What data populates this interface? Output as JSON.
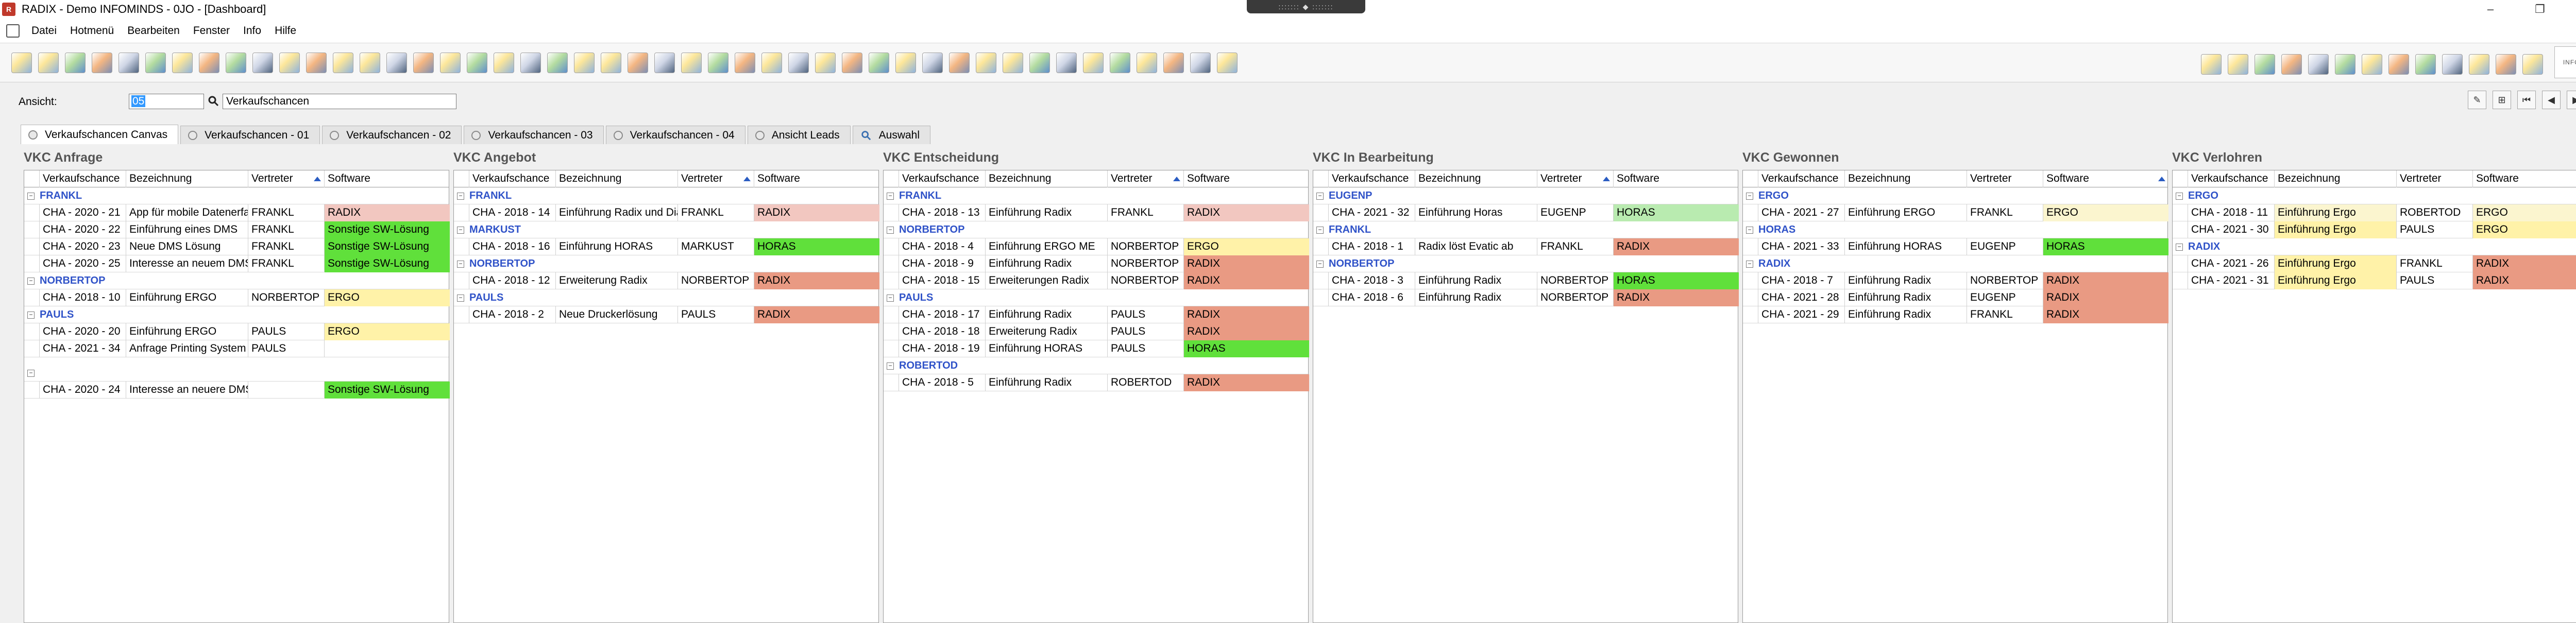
{
  "window": {
    "title": "RADIX - Demo INFOMINDS - 0JO - [Dashboard]",
    "controls": [
      "–",
      "❐",
      "✕"
    ]
  },
  "menu": [
    "Datei",
    "Hotmenü",
    "Bearbeiten",
    "Fenster",
    "Info",
    "Hilfe"
  ],
  "view": {
    "label": "Ansicht:",
    "code": "05",
    "name": "Verkaufschancen"
  },
  "tabs": [
    "Verkaufschancen Canvas",
    "Verkaufschancen - 01",
    "Verkaufschancen - 02",
    "Verkaufschancen - 03",
    "Verkaufschancen - 04",
    "Ansicht Leads",
    "Auswahl"
  ],
  "headers": [
    "Verkaufschance",
    "Bezeichnung",
    "Vertreter",
    "Software"
  ],
  "colors": {
    "RADIX": "#e99a83",
    "RADIX_LIGHT": "#f2c7c0",
    "HORAS": "#60e03b",
    "HORAS_LIGHT": "#b9ebb0",
    "ERGO": "#fff2a8",
    "ERGO_LIGHT": "#fbf5cf",
    "SW": "#60e03b",
    "group_text": "#2f52c8"
  },
  "columns": [
    {
      "title": "VKC Anfrage",
      "groups": [
        {
          "name": "FRANKL",
          "rows": [
            {
              "id": "CHA - 2020 - 21",
              "desc": "App für mobile Datenerfa",
              "rep": "FRANKL",
              "sw": "RADIX",
              "c": "RADIX_LIGHT"
            },
            {
              "id": "CHA - 2020 - 22",
              "desc": "Einführung eines DMS",
              "rep": "FRANKL",
              "sw": "Sonstige SW-Lösung",
              "c": "SW"
            },
            {
              "id": "CHA - 2020 - 23",
              "desc": "Neue DMS Lösung",
              "rep": "FRANKL",
              "sw": "Sonstige SW-Lösung",
              "c": "SW"
            },
            {
              "id": "CHA - 2020 - 25",
              "desc": "Interesse an neuem DMS",
              "rep": "FRANKL",
              "sw": "Sonstige SW-Lösung",
              "c": "SW"
            }
          ]
        },
        {
          "name": "NORBERTOP",
          "rows": [
            {
              "id": "CHA - 2018 - 10",
              "desc": "Einführung ERGO",
              "rep": "NORBERTOP",
              "sw": "ERGO",
              "c": "ERGO"
            }
          ]
        },
        {
          "name": "PAULS",
          "rows": [
            {
              "id": "CHA - 2020 - 20",
              "desc": "Einführung ERGO",
              "rep": "PAULS",
              "sw": "ERGO",
              "c": "ERGO"
            },
            {
              "id": "CHA - 2021 - 34",
              "desc": "Anfrage Printing System",
              "rep": "PAULS",
              "sw": "",
              "c": ""
            }
          ]
        },
        {
          "name": "",
          "rows": [
            {
              "id": "CHA - 2020 - 24",
              "desc": "Interesse an neuere DMS",
              "rep": "",
              "sw": "Sonstige SW-Lösung",
              "c": "SW"
            }
          ]
        }
      ]
    },
    {
      "title": "VKC Angebot",
      "groups": [
        {
          "name": "FRANKL",
          "rows": [
            {
              "id": "CHA - 2018 - 14",
              "desc": "Einführung Radix und Diamant",
              "rep": "FRANKL",
              "sw": "RADIX",
              "c": "RADIX_LIGHT"
            }
          ]
        },
        {
          "name": "MARKUST",
          "rows": [
            {
              "id": "CHA - 2018 - 16",
              "desc": "Einführung HORAS",
              "rep": "MARKUST",
              "sw": "HORAS",
              "c": "HORAS"
            }
          ]
        },
        {
          "name": "NORBERTOP",
          "rows": [
            {
              "id": "CHA - 2018 - 12",
              "desc": "Erweiterung Radix",
              "rep": "NORBERTOP",
              "sw": "RADIX",
              "c": "RADIX"
            }
          ]
        },
        {
          "name": "PAULS",
          "rows": [
            {
              "id": "CHA - 2018 - 2",
              "desc": "Neue Druckerlösung",
              "rep": "PAULS",
              "sw": "RADIX",
              "c": "RADIX"
            }
          ]
        }
      ]
    },
    {
      "title": "VKC Entscheidung",
      "groups": [
        {
          "name": "FRANKL",
          "rows": [
            {
              "id": "CHA - 2018 - 13",
              "desc": "Einführung Radix",
              "rep": "FRANKL",
              "sw": "RADIX",
              "c": "RADIX_LIGHT"
            }
          ]
        },
        {
          "name": "NORBERTOP",
          "rows": [
            {
              "id": "CHA - 2018 - 4",
              "desc": "Einführung ERGO ME",
              "rep": "NORBERTOP",
              "sw": "ERGO",
              "c": "ERGO"
            },
            {
              "id": "CHA - 2018 - 9",
              "desc": "Einführung Radix",
              "rep": "NORBERTOP",
              "sw": "RADIX",
              "c": "RADIX"
            },
            {
              "id": "CHA - 2018 - 15",
              "desc": "Erweiterungen Radix",
              "rep": "NORBERTOP",
              "sw": "RADIX",
              "c": "RADIX"
            }
          ]
        },
        {
          "name": "PAULS",
          "rows": [
            {
              "id": "CHA - 2018 - 17",
              "desc": "Einführung Radix",
              "rep": "PAULS",
              "sw": "RADIX",
              "c": "RADIX"
            },
            {
              "id": "CHA - 2018 - 18",
              "desc": "Erweiterung Radix",
              "rep": "PAULS",
              "sw": "RADIX",
              "c": "RADIX"
            },
            {
              "id": "CHA - 2018 - 19",
              "desc": "Einführung HORAS",
              "rep": "PAULS",
              "sw": "HORAS",
              "c": "HORAS"
            }
          ]
        },
        {
          "name": "ROBERTOD",
          "rows": [
            {
              "id": "CHA - 2018 - 5",
              "desc": "Einführung Radix",
              "rep": "ROBERTOD",
              "sw": "RADIX",
              "c": "RADIX"
            }
          ]
        }
      ]
    },
    {
      "title": "VKC In Bearbeitung",
      "groups": [
        {
          "name": "EUGENP",
          "rows": [
            {
              "id": "CHA - 2021 - 32",
              "desc": "Einführung Horas",
              "rep": "EUGENP",
              "sw": "HORAS",
              "c": "HORAS_LIGHT"
            }
          ]
        },
        {
          "name": "FRANKL",
          "rows": [
            {
              "id": "CHA - 2018 - 1",
              "desc": "Radix löst Evatic ab",
              "rep": "FRANKL",
              "sw": "RADIX",
              "c": "RADIX"
            }
          ]
        },
        {
          "name": "NORBERTOP",
          "rows": [
            {
              "id": "CHA - 2018 - 3",
              "desc": "Einführung Radix",
              "rep": "NORBERTOP",
              "sw": "HORAS",
              "c": "HORAS"
            },
            {
              "id": "CHA - 2018 - 6",
              "desc": "Einführung Radix",
              "rep": "NORBERTOP",
              "sw": "RADIX",
              "c": "RADIX"
            }
          ]
        }
      ]
    },
    {
      "title": "VKC Gewonnen",
      "groups": [
        {
          "name": "ERGO",
          "rows": [
            {
              "id": "CHA - 2021 - 27",
              "desc": "Einführung ERGO",
              "rep": "FRANKL",
              "sw": "ERGO",
              "c": "ERGO_LIGHT"
            }
          ]
        },
        {
          "name": "HORAS",
          "rows": [
            {
              "id": "CHA - 2021 - 33",
              "desc": "Einführung HORAS",
              "rep": "EUGENP",
              "sw": "HORAS",
              "c": "HORAS"
            }
          ]
        },
        {
          "name": "RADIX",
          "rows": [
            {
              "id": "CHA - 2018 - 7",
              "desc": "Einführung Radix",
              "rep": "NORBERTOP",
              "sw": "RADIX",
              "c": "RADIX"
            },
            {
              "id": "CHA - 2021 - 28",
              "desc": "Einführung Radix",
              "rep": "EUGENP",
              "sw": "RADIX",
              "c": "RADIX"
            },
            {
              "id": "CHA - 2021 - 29",
              "desc": "Einführung Radix",
              "rep": "FRANKL",
              "sw": "RADIX",
              "c": "RADIX"
            }
          ]
        }
      ]
    },
    {
      "title": "VKC Verlohren",
      "groups": [
        {
          "name": "ERGO",
          "rows": [
            {
              "id": "CHA - 2018 - 11",
              "desc": "Einführung Ergo",
              "rep": "ROBERTOD",
              "sw": "ERGO",
              "c": "ERGO_LIGHT",
              "dc": "ERGO_LIGHT"
            },
            {
              "id": "CHA - 2021 - 30",
              "desc": "Einführung Ergo",
              "rep": "PAULS",
              "sw": "ERGO",
              "c": "ERGO",
              "dc": "ERGO"
            }
          ]
        },
        {
          "name": "RADIX",
          "rows": [
            {
              "id": "CHA - 2021 - 26",
              "desc": "Einführung Ergo",
              "rep": "FRANKL",
              "sw": "RADIX",
              "c": "RADIX",
              "dc": "ERGO"
            },
            {
              "id": "CHA - 2021 - 31",
              "desc": "Einführung Ergo",
              "rep": "PAULS",
              "sw": "RADIX",
              "c": "RADIX",
              "dc": "ERGO"
            }
          ]
        }
      ]
    }
  ]
}
